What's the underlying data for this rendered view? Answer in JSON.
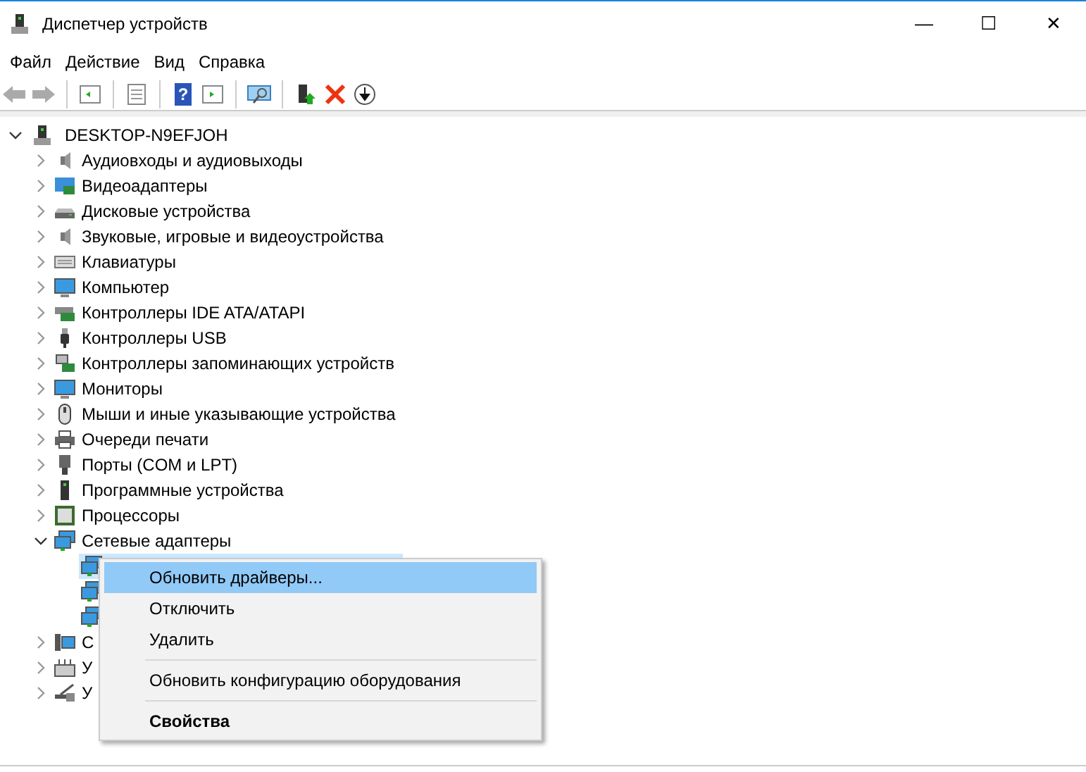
{
  "window": {
    "title": "Диспетчер устройств",
    "controls": [
      "—",
      "☐",
      "✕"
    ]
  },
  "menu": [
    "Файл",
    "Действие",
    "Вид",
    "Справка"
  ],
  "toolbar": {
    "help_glyph": "?"
  },
  "tree": {
    "label": "DESKTOP-N9EFJOH",
    "expanded": true,
    "children": [
      {
        "label": "Аудиовходы и аудиовыходы",
        "expanded": false
      },
      {
        "label": "Видеоадаптеры",
        "expanded": false
      },
      {
        "label": "Дисковые устройства",
        "expanded": false
      },
      {
        "label": "Звуковые, игровые и видеоустройства",
        "expanded": false
      },
      {
        "label": "Клавиатуры",
        "expanded": false
      },
      {
        "label": "Компьютер",
        "expanded": false
      },
      {
        "label": "Контроллеры IDE ATA/ATAPI",
        "expanded": false
      },
      {
        "label": "Контроллеры USB",
        "expanded": false
      },
      {
        "label": "Контроллеры запоминающих устройств",
        "expanded": false
      },
      {
        "label": "Мониторы",
        "expanded": false
      },
      {
        "label": "Мыши и иные указывающие устройства",
        "expanded": false
      },
      {
        "label": "Очереди печати",
        "expanded": false
      },
      {
        "label": "Порты (COM и LPT)",
        "expanded": false
      },
      {
        "label": "Программные устройства",
        "expanded": false
      },
      {
        "label": "Процессоры",
        "expanded": false
      },
      {
        "label": "Сетевые адаптеры",
        "expanded": true,
        "children": [
          {
            "selected": true
          },
          {
            "selected": false
          },
          {
            "selected": false
          }
        ]
      },
      {
        "label": "С",
        "expanded": false
      },
      {
        "label": "У",
        "expanded": false
      },
      {
        "label": "У",
        "expanded": false
      }
    ]
  },
  "context_menu": [
    {
      "kind": "item",
      "label": "Обновить драйверы...",
      "selected": true,
      "default": false
    },
    {
      "kind": "item",
      "label": "Отключить",
      "selected": false,
      "default": false
    },
    {
      "kind": "item",
      "label": "Удалить",
      "selected": false,
      "default": false
    },
    {
      "kind": "separator"
    },
    {
      "kind": "item",
      "label": "Обновить конфигурацию оборудования",
      "selected": false,
      "default": false
    },
    {
      "kind": "separator"
    },
    {
      "kind": "item",
      "label": "Свойства",
      "selected": false,
      "default": true
    }
  ]
}
